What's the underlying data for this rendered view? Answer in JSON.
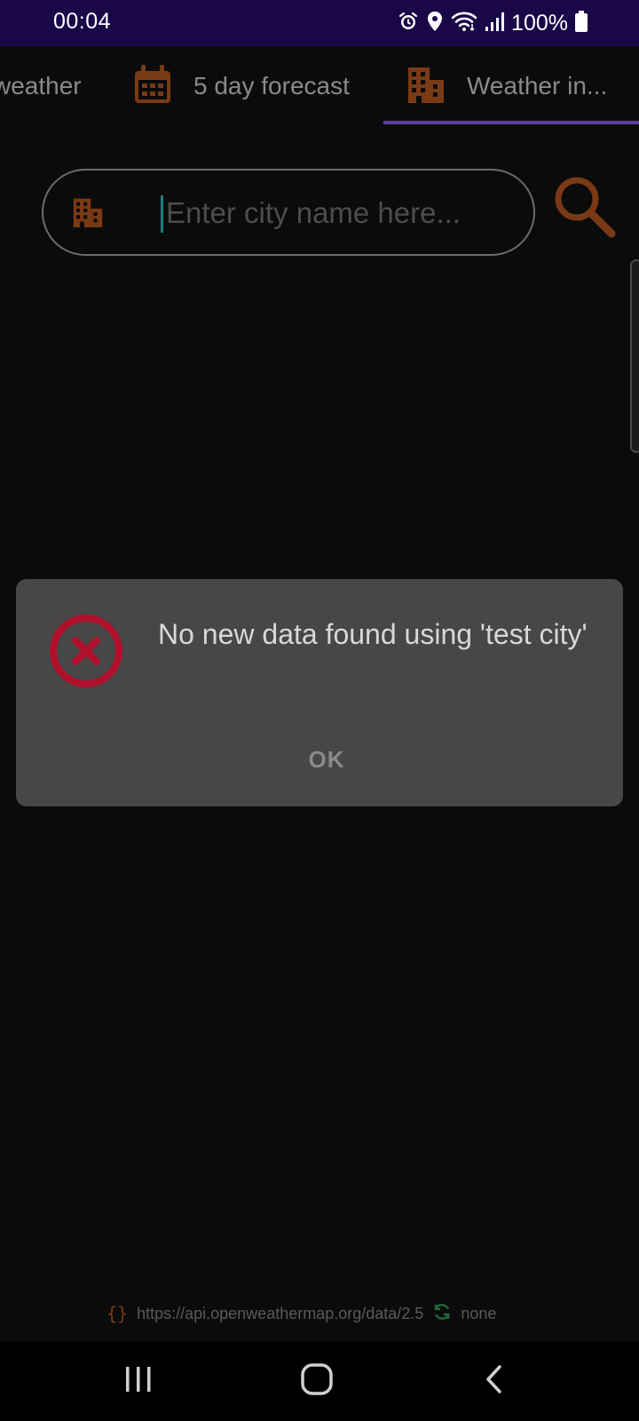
{
  "status_bar": {
    "time": "00:04",
    "battery": "100%",
    "icons": [
      "alarm-icon",
      "location-icon",
      "wifi-icon",
      "signal-icon",
      "battery-icon"
    ]
  },
  "tabs": [
    {
      "label": "weather",
      "icon": "",
      "selected": false
    },
    {
      "label": "5 day forecast",
      "icon": "calendar-icon",
      "selected": false
    },
    {
      "label": "Weather in...",
      "icon": "city-icon",
      "selected": true
    }
  ],
  "search": {
    "placeholder": "Enter city name here...",
    "value": "",
    "leading_icon": "city-icon",
    "button_icon": "search-icon"
  },
  "dialog": {
    "icon": "error-icon",
    "message": "No new data found using 'test city'",
    "ok_label": "OK"
  },
  "footer": {
    "url": "https://api.openweathermap.org/data/2.5",
    "status": "none"
  },
  "colors": {
    "status_bar": "#1a0747",
    "accent_orange": "#7a3a15",
    "tab_indicator": "#5b3e9e",
    "error_red": "#b0102c",
    "dialog_bg": "#474747",
    "background": "#0b0b0b"
  }
}
